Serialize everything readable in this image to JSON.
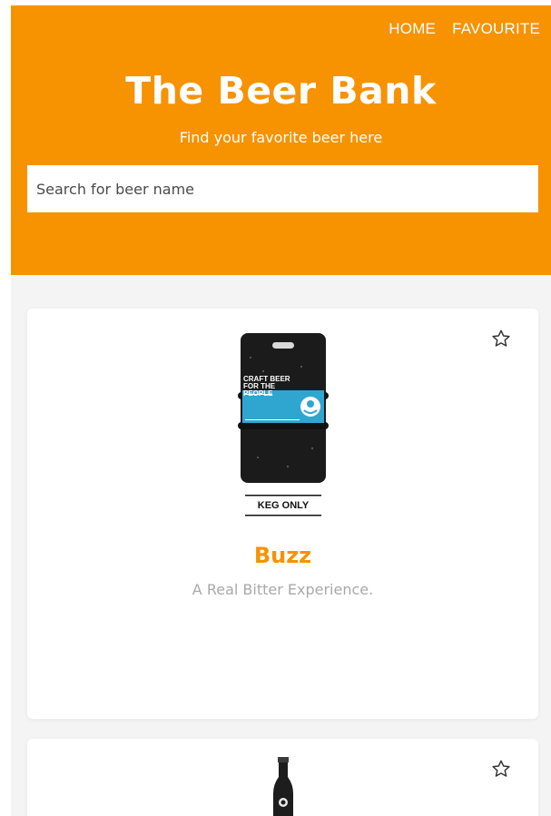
{
  "nav": {
    "home": "HOME",
    "favourite": "FAVOURITE"
  },
  "header": {
    "title": "The Beer Bank",
    "subtitle": "Find your favorite beer here",
    "search_placeholder": "Search for beer name"
  },
  "colors": {
    "brand": "#f79200",
    "background": "#f4f4f4",
    "muted_text": "#a9a9a9"
  },
  "beers": [
    {
      "name": "Buzz",
      "tagline": "A Real Bitter Experience.",
      "image": "keg-icon",
      "image_label": "KEG ONLY",
      "image_sticker": "CRAFT BEER FOR THE PEOPLE"
    },
    {
      "name": "",
      "tagline": "",
      "image": "bottle-icon"
    }
  ]
}
